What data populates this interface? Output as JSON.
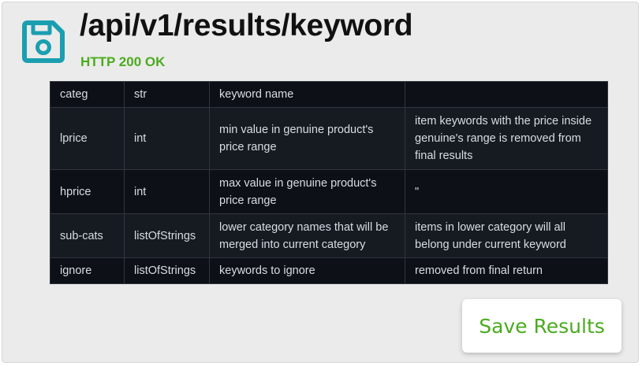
{
  "header": {
    "icon": "floppy-disk-save-icon",
    "title": "/api/v1/results/keyword",
    "status": "HTTP 200 OK"
  },
  "table": {
    "rows": [
      [
        "categ",
        "str",
        "keyword name",
        ""
      ],
      [
        "lprice",
        "int",
        "min value in genuine product's price range",
        "item keywords with the price inside genuine's range is removed from final results"
      ],
      [
        "hprice",
        "int",
        "max value in genuine product's price range",
        "\""
      ],
      [
        "sub-cats",
        "listOfStrings",
        "lower category names that will be merged into current category",
        "items in lower category will all belong under current keyword"
      ],
      [
        "ignore",
        "listOfStrings",
        "keywords to ignore",
        "removed from final return"
      ]
    ]
  },
  "actions": {
    "save_label": "Save Results"
  },
  "colors": {
    "accent": "#4bab1e",
    "icon": "#1a9fb0",
    "table_bg": "#0d1117",
    "card_bg": "#ebebeb"
  }
}
